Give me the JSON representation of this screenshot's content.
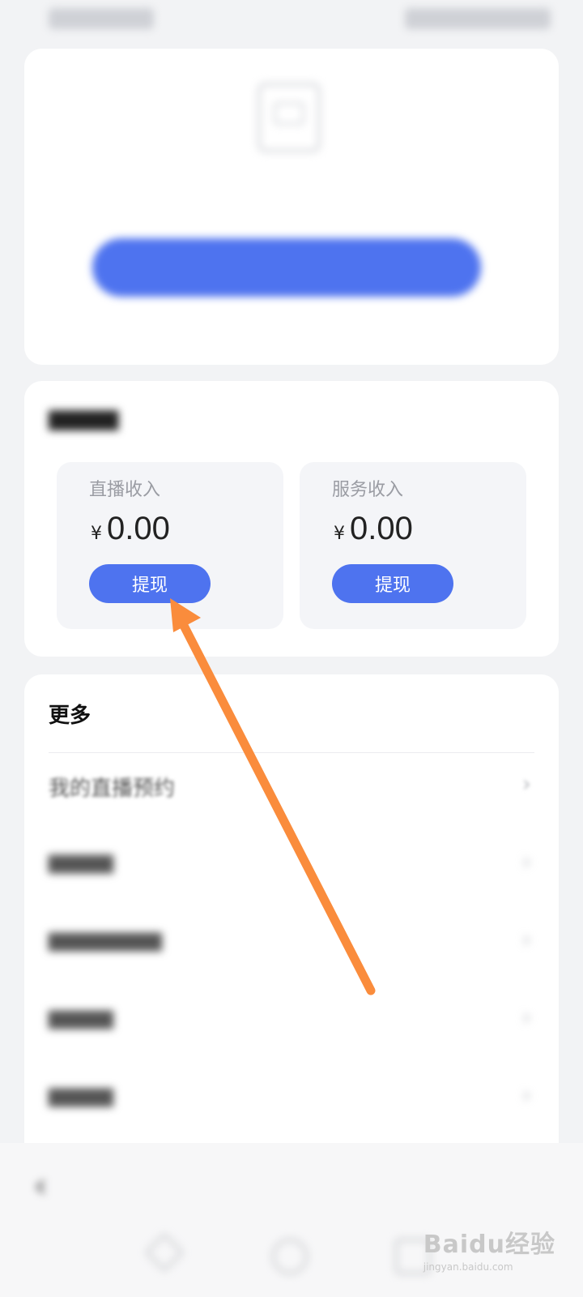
{
  "income": {
    "items": [
      {
        "label": "直播收入",
        "currency": "¥",
        "amount": "0.00",
        "button": "提现"
      },
      {
        "label": "服务收入",
        "currency": "¥",
        "amount": "0.00",
        "button": "提现"
      }
    ]
  },
  "more": {
    "title": "更多",
    "items": [
      {
        "label": "我的直播预约"
      }
    ]
  },
  "watermark": {
    "logo": "Baidu经验",
    "url": "jingyan.baidu.com"
  },
  "colors": {
    "accent": "#4e73ef",
    "arrow": "#fa8c3c"
  },
  "icons": {
    "chevron": "chevron-right-icon",
    "back": "back-arrow-icon"
  }
}
